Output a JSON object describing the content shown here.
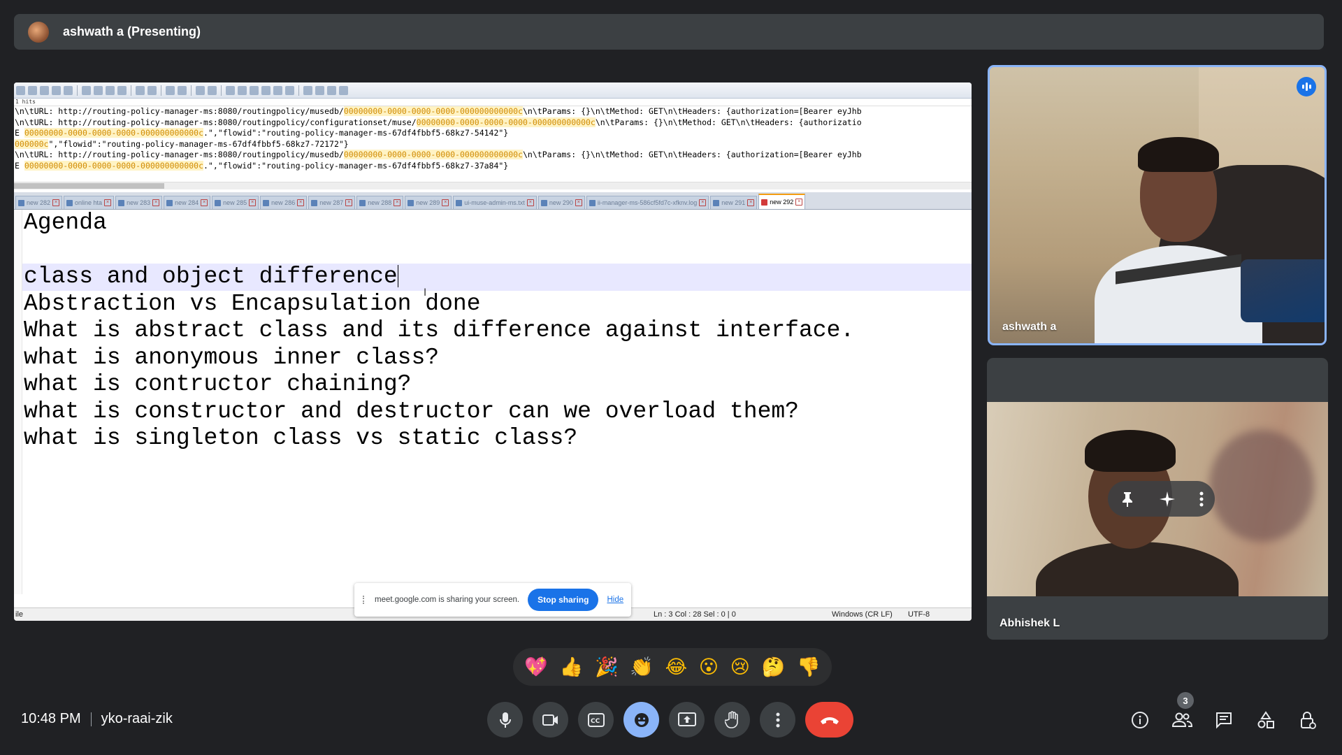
{
  "presenter_bar": {
    "label": "ashwath a (Presenting)"
  },
  "shared_screen": {
    "hits_label": "1 hits",
    "log_lines": [
      {
        "pre": "\\n\\tURL: http://routing-policy-manager-ms:8080/routingpolicy/musedb/",
        "hl": "00000000-0000-0000-0000-000000000000c",
        "post": "\\n\\tParams: {}\\n\\tMethod: GET\\n\\tHeaders: {authorization=[Bearer eyJhb"
      },
      {
        "pre": "\\n\\tURL: http://routing-policy-manager-ms:8080/routingpolicy/configurationset/muse/",
        "hl": "00000000-0000-0000-0000-000000000000c",
        "post": "\\n\\tParams: {}\\n\\tMethod: GET\\n\\tHeaders: {authorizatio"
      },
      {
        "pre": "E ",
        "hl": "00000000-0000-0000-0000-000000000000c",
        "post": ".\",\"flowid\":\"routing-policy-manager-ms-67df4fbbf5-68kz7-54142\"}"
      },
      {
        "pre": "",
        "hl": "000000c",
        "post": "\",\"flowid\":\"routing-policy-manager-ms-67df4fbbf5-68kz7-72172\"}"
      },
      {
        "pre": "\\n\\tURL: http://routing-policy-manager-ms:8080/routingpolicy/musedb/",
        "hl": "00000000-0000-0000-0000-000000000000c",
        "post": "\\n\\tParams: {}\\n\\tMethod: GET\\n\\tHeaders: {authorization=[Bearer eyJhb"
      },
      {
        "pre": "E ",
        "hl": "00000000-0000-0000-0000-000000000000c",
        "post": ".\",\"flowid\":\"routing-policy-manager-ms-67df4fbbf5-68kz7-37a84\"}"
      }
    ],
    "tabs": [
      "new 282",
      "online hta",
      "new 283",
      "new 284",
      "new 285",
      "new 286",
      "new 287",
      "new 288",
      "new 289",
      "ui-muse-admin-ms.txt",
      "new 290",
      "ii-manager-ms-586cf5fd7c-xfknv.log",
      "new 291",
      "new 292"
    ],
    "editor_lines": [
      "Agenda",
      "",
      "class and object difference",
      "Abstraction vs Encapsulation done",
      "What is abstract class and its difference against interface.",
      "what is anonymous inner class?",
      "what is contructor chaining?",
      "what is constructor and destructor can we overload them?",
      "what is singleton class vs static class?"
    ],
    "status": {
      "left": "ile",
      "position": "Ln : 3    Col : 28    Sel : 0 | 0",
      "eol": "Windows (CR LF)",
      "encoding": "UTF-8"
    },
    "share_banner": {
      "message": "meet.google.com is sharing your screen.",
      "stop_label": "Stop sharing",
      "hide_label": "Hide"
    }
  },
  "participants": [
    {
      "name": "ashwath a",
      "speaking": true
    },
    {
      "name": "Abhishek L",
      "speaking": false
    }
  ],
  "reactions": [
    "💖",
    "👍",
    "🎉",
    "👏",
    "😂",
    "😮",
    "😢",
    "🤔",
    "👎"
  ],
  "meeting": {
    "time": "10:48 PM",
    "code": "yko-raai-zik"
  },
  "controls": [
    "mic-icon",
    "camera-icon",
    "captions-icon",
    "emoji-icon",
    "present-icon",
    "raise-hand-icon",
    "more-icon",
    "end-call-icon"
  ],
  "right_controls": {
    "people_count": "3"
  },
  "colors": {
    "background": "#202124",
    "active_speaker_border": "#8ab4f8",
    "end_call": "#ea4335",
    "primary_blue": "#1a73e8"
  }
}
